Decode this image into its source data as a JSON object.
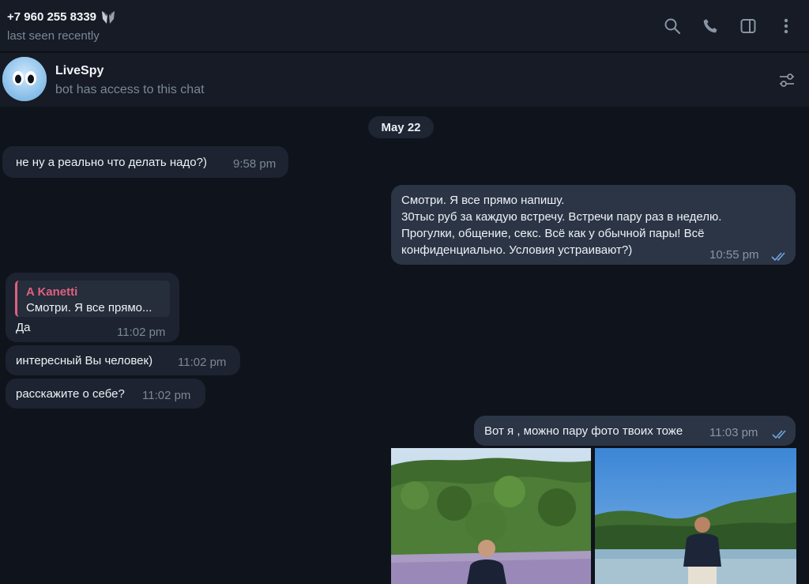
{
  "header": {
    "peer_name": "+7 960 255 8339",
    "peer_status": "last seen recently",
    "icons": [
      "search-icon",
      "phone-icon",
      "sidebar-toggle-icon",
      "more-vertical-icon"
    ]
  },
  "bot": {
    "name": "LiveSpy",
    "description": "bot has access to this chat",
    "settings_icon": "sliders-icon"
  },
  "chat": {
    "date": "May 22",
    "messages": [
      {
        "dir": "in",
        "text": "не ну а реально что делать надо?)",
        "time": "9:58 pm"
      },
      {
        "dir": "out",
        "lines": [
          "Смотри. Я все прямо напишу.",
          "30тыс руб за каждую встречу. Встречи пару раз в неделю.",
          "Прогулки, общение, секс. Всё как у обычной пары! Всё",
          "конфиденциально. Условия устраивают?)"
        ],
        "time": "10:55 pm",
        "read": true
      },
      {
        "dir": "in",
        "reply_name": "A Kanetti",
        "reply_text": "Смотри. Я все прямо...",
        "text": "Да",
        "time": "11:02 pm"
      },
      {
        "dir": "in",
        "text": "интересный Вы человек)",
        "time": "11:02 pm"
      },
      {
        "dir": "in",
        "text": "расскажите о себе?",
        "time": "11:02 pm"
      },
      {
        "dir": "out",
        "text": "Вот я , можно пару фото твоих тоже",
        "time": "11:03 pm",
        "read": true
      }
    ]
  },
  "colors": {
    "background": "#0f131c",
    "incoming_bubble": "#1d2330",
    "outgoing_bubble": "#2b3545",
    "reply_accent": "#e0607e",
    "read_ticks": "#6fa6e0"
  }
}
